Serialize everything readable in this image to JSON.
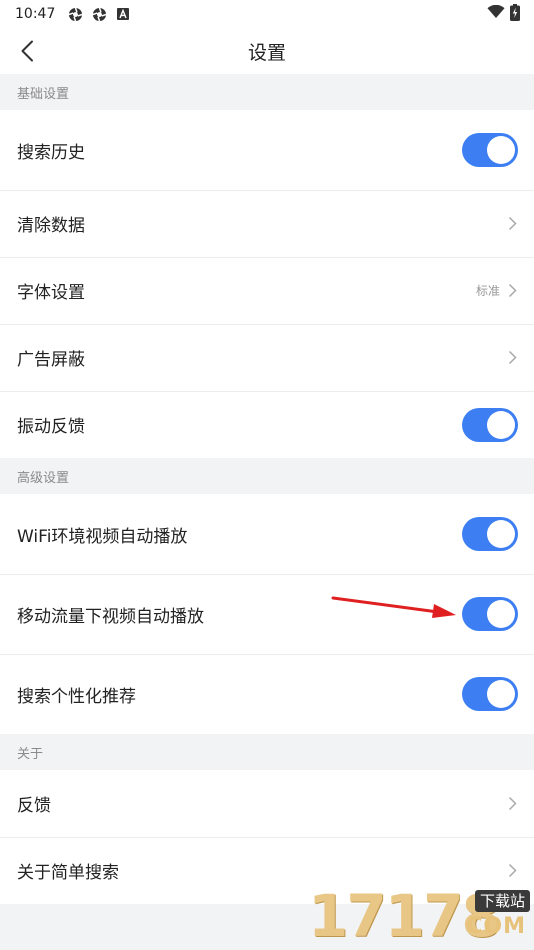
{
  "status_bar": {
    "time": "10:47",
    "icons": [
      "aperture-icon",
      "aperture-icon",
      "notification-a-icon"
    ],
    "right_icons": [
      "wifi-icon",
      "battery-charging-icon"
    ]
  },
  "nav": {
    "back_icon": "chevron-left-icon",
    "title": "设置"
  },
  "sections": {
    "basic": {
      "header": "基础设置",
      "items": [
        {
          "label": "搜索历史",
          "control": "toggle",
          "on": true
        },
        {
          "label": "清除数据",
          "control": "chevron"
        },
        {
          "label": "字体设置",
          "control": "chevron",
          "value": "标准"
        },
        {
          "label": "广告屏蔽",
          "control": "chevron"
        },
        {
          "label": "振动反馈",
          "control": "toggle",
          "on": true
        }
      ]
    },
    "advanced": {
      "header": "高级设置",
      "items": [
        {
          "label": "WiFi环境视频自动播放",
          "control": "toggle",
          "on": true
        },
        {
          "label": "移动流量下视频自动播放",
          "control": "toggle",
          "on": true
        },
        {
          "label": "搜索个性化推荐",
          "control": "toggle",
          "on": true
        }
      ]
    },
    "about": {
      "header": "关于",
      "items": [
        {
          "label": "反馈",
          "control": "chevron"
        },
        {
          "label": "关于简单搜索",
          "control": "chevron"
        }
      ]
    }
  },
  "colors": {
    "toggle_on": "#3d7ff2",
    "annotation_arrow": "#e02020",
    "page_bg": "#f2f3f5"
  },
  "watermark": {
    "digits": "17178",
    "badge": "下载站",
    "suffix": "COM"
  }
}
